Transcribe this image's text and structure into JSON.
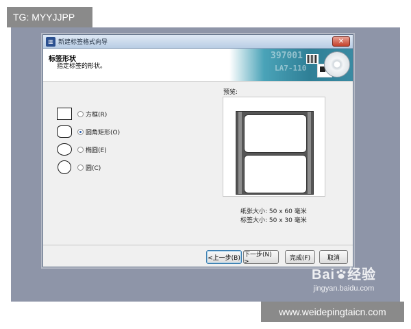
{
  "overlay": {
    "tg_label": "TG: MYYJJPP",
    "site_label": "www.weidepingtaicn.com",
    "watermark_brand": "Bai",
    "watermark_brand_cn": "经验",
    "watermark_url": "jingyan.baidu.com"
  },
  "window": {
    "title": "新建标签格式向导",
    "close_label": "✕",
    "header_title": "标签形状",
    "header_subtitle": "指定标签的形状。",
    "banner_text1": "397001",
    "banner_text2": "LA7-110"
  },
  "shapes": [
    {
      "label": "方框(R)",
      "selected": false
    },
    {
      "label": "圆角矩形(O)",
      "selected": true
    },
    {
      "label": "椭圆(E)",
      "selected": false
    },
    {
      "label": "圆(C)",
      "selected": false
    }
  ],
  "preview": {
    "label": "预览:",
    "paper_size": "纸张大小: 50 x 60 毫米",
    "label_size": "标签大小: 50 x 30 毫米"
  },
  "buttons": {
    "back": "<上一步(B)",
    "next": "下一步(N) >",
    "finish": "完成(F)",
    "cancel": "取消"
  },
  "colors": {
    "frame_bg": "#8e95a8",
    "overlay_bg": "#8a8a8a",
    "banner_teal": "#2f7f96",
    "selected_radio": "#2a5fb0"
  }
}
